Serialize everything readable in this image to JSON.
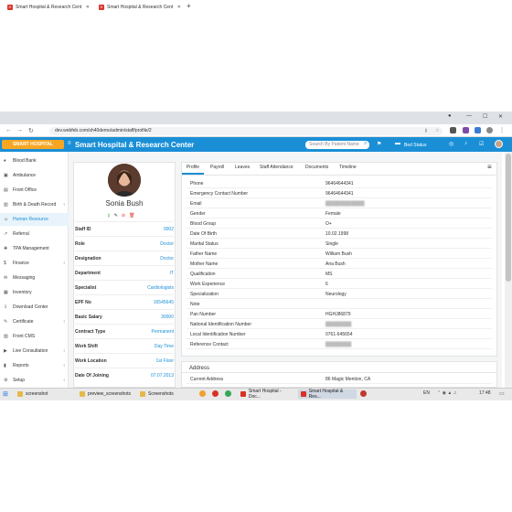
{
  "browser": {
    "tabs": [
      {
        "label": "Smart Hospital & Research Cent"
      },
      {
        "label": "Smart Hospital & Research Cent"
      }
    ],
    "url": "dev.webfeb.com/sh40demo/admin/staff/profile/2"
  },
  "header": {
    "logo_text": "SMART HOSPITAL",
    "title": "Smart Hospital & Research Center",
    "search_placeholder": "Search By Patient Name",
    "bed_status": "Bed Status",
    "accent_color": "#1a8fd6"
  },
  "sidebar": {
    "items": [
      {
        "label": "Blood Bank",
        "icon": "blood-drop-icon"
      },
      {
        "label": "Ambulance",
        "icon": "ambulance-icon"
      },
      {
        "label": "Front Office",
        "icon": "front-office-icon"
      },
      {
        "label": "Birth & Death Record",
        "icon": "record-icon",
        "chevron": "‹"
      },
      {
        "label": "Human Resource",
        "icon": "users-icon"
      },
      {
        "label": "Referral",
        "icon": "referral-icon"
      },
      {
        "label": "TPA Management",
        "icon": "tpa-icon"
      },
      {
        "label": "Finance",
        "icon": "finance-icon",
        "chevron": "‹"
      },
      {
        "label": "Messaging",
        "icon": "message-icon"
      },
      {
        "label": "Inventory",
        "icon": "inventory-icon"
      },
      {
        "label": "Download Center",
        "icon": "download-icon"
      },
      {
        "label": "Certificate",
        "icon": "certificate-icon",
        "chevron": "‹"
      },
      {
        "label": "Front CMS",
        "icon": "cms-icon"
      },
      {
        "label": "Live Consultation",
        "icon": "video-icon",
        "chevron": "‹"
      },
      {
        "label": "Reports",
        "icon": "reports-icon",
        "chevron": "‹"
      },
      {
        "label": "Setup",
        "icon": "gear-icon",
        "chevron": "‹"
      }
    ]
  },
  "profile": {
    "name": "Sonia Bush",
    "rows": [
      {
        "key": "Staff ID",
        "value": "0002"
      },
      {
        "key": "Role",
        "value": "Doctor"
      },
      {
        "key": "Designation",
        "value": "Doctor"
      },
      {
        "key": "Department",
        "value": "IT"
      },
      {
        "key": "Specialist",
        "value": "Cardiologists"
      },
      {
        "key": "EPF No",
        "value": "16545645"
      },
      {
        "key": "Basic Salary",
        "value": "30000"
      },
      {
        "key": "Contract Type",
        "value": "Permanent"
      },
      {
        "key": "Work Shift",
        "value": "Day Time"
      },
      {
        "key": "Work Location",
        "value": "1st Floor"
      },
      {
        "key": "Date Of Joining",
        "value": "07.07.2013"
      }
    ]
  },
  "tabs": [
    "Profile",
    "Payroll",
    "Leaves",
    "Staff Attendance",
    "Documents",
    "Timeline"
  ],
  "details": [
    {
      "key": "Phone",
      "value": "96464644341"
    },
    {
      "key": "Emergency Contact Number",
      "value": "96464644341"
    },
    {
      "key": "Email",
      "value": ""
    },
    {
      "key": "Gender",
      "value": "Female"
    },
    {
      "key": "Blood Group",
      "value": "O+"
    },
    {
      "key": "Date Of Birth",
      "value": "10.02.1998"
    },
    {
      "key": "Marital Status",
      "value": "Single"
    },
    {
      "key": "Father Name",
      "value": "William Bush"
    },
    {
      "key": "Mother Name",
      "value": "Ana Bush"
    },
    {
      "key": "Qualification",
      "value": "MS"
    },
    {
      "key": "Work Experience",
      "value": "6"
    },
    {
      "key": "Specialization",
      "value": "Neurology"
    },
    {
      "key": "Note",
      "value": ""
    },
    {
      "key": "Pan Number",
      "value": "HGHJ86879"
    },
    {
      "key": "National Identification Number",
      "value": ""
    },
    {
      "key": "Local Identification Number",
      "value": "0761-645654"
    },
    {
      "key": "Reference Contact",
      "value": ""
    }
  ],
  "address": {
    "title": "Address",
    "row": {
      "key": "Current Address",
      "value": "86 Magic Mention, CA"
    }
  },
  "taskbar": {
    "items": [
      "screenshot",
      "preview_screenshots",
      "Screenshots",
      "Smart Hospital - Doc...",
      "Smart Hospital & Res..."
    ],
    "lang": "EN",
    "time": "17:48"
  }
}
